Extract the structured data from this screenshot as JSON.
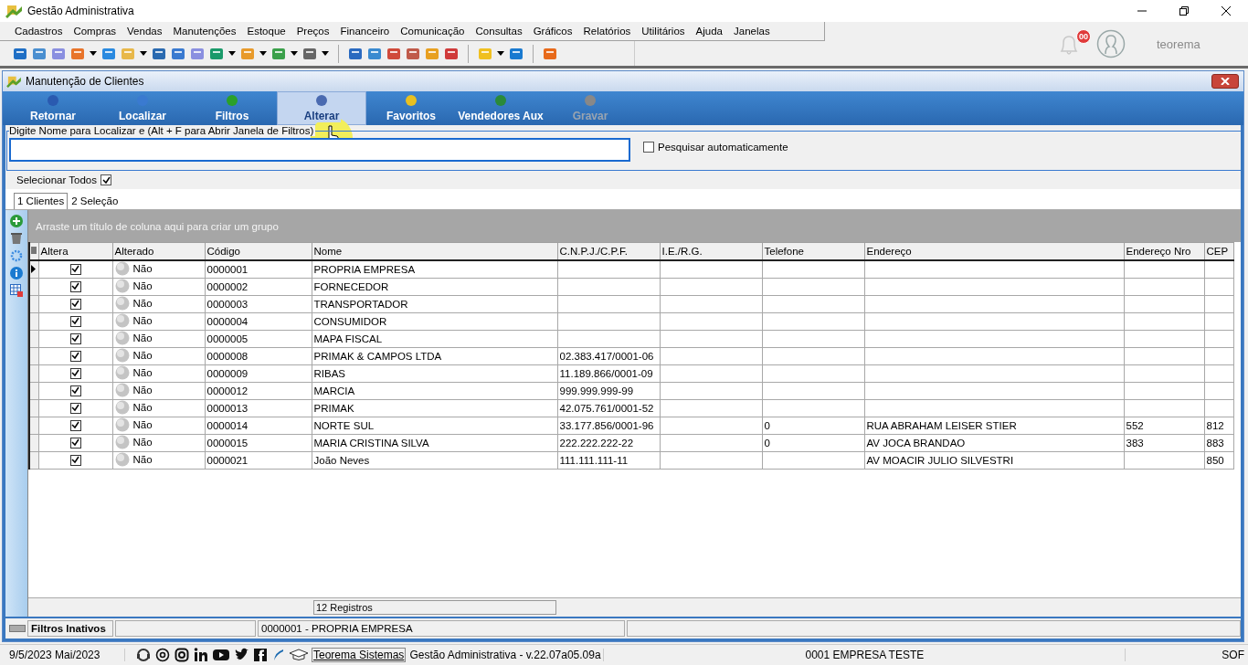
{
  "window": {
    "title": "Gestão Administrativa"
  },
  "menu": [
    "Cadastros",
    "Compras",
    "Vendas",
    "Manutenções",
    "Estoque",
    "Preços",
    "Financeiro",
    "Comunicação",
    "Consultas",
    "Gráficos",
    "Relatórios",
    "Utilitários",
    "Ajuda",
    "Janelas"
  ],
  "user": {
    "notifications": "00",
    "name": "teorema"
  },
  "child_window": {
    "title": "Manutenção de Clientes"
  },
  "ribbon": [
    {
      "label": "Retornar",
      "selected": false,
      "disabled": false
    },
    {
      "label": "Localizar",
      "selected": false,
      "disabled": false
    },
    {
      "label": "Filtros",
      "selected": false,
      "disabled": false
    },
    {
      "label": "Alterar",
      "selected": true,
      "disabled": false
    },
    {
      "label": "Favoritos",
      "selected": false,
      "disabled": false
    },
    {
      "label": "Vendedores Aux",
      "selected": false,
      "disabled": false
    },
    {
      "label": "Gravar",
      "selected": false,
      "disabled": true
    }
  ],
  "search": {
    "legend": "Digite Nome para Localizar e (Alt + F para Abrir Janela de Filtros)",
    "auto_search": {
      "label": "Pesquisar automaticamente",
      "checked": false
    }
  },
  "select_all": {
    "label": "Selecionar Todos",
    "checked": true
  },
  "tabs": [
    {
      "label": "1 Clientes",
      "selected": true
    },
    {
      "label": "2 Seleção",
      "selected": false
    }
  ],
  "group_hint": "Arraste um título de coluna aqui para criar um grupo",
  "table": {
    "columns": [
      "Altera",
      "Alterado",
      "Código",
      "Nome",
      "C.N.P.J./C.P.F.",
      "I.E./R.G.",
      "Telefone",
      "Endereço",
      "Endereço Nro",
      "CEP"
    ],
    "rows": [
      {
        "current": true,
        "checked": true,
        "cells": [
          "",
          "Não",
          "0000001",
          "PROPRIA EMPRESA",
          "",
          "",
          "",
          "",
          "",
          ""
        ]
      },
      {
        "current": false,
        "checked": true,
        "cells": [
          "",
          "Não",
          "0000002",
          "FORNECEDOR",
          "",
          "",
          "",
          "",
          "",
          ""
        ]
      },
      {
        "current": false,
        "checked": true,
        "cells": [
          "",
          "Não",
          "0000003",
          "TRANSPORTADOR",
          "",
          "",
          "",
          "",
          "",
          ""
        ]
      },
      {
        "current": false,
        "checked": true,
        "cells": [
          "",
          "Não",
          "0000004",
          "CONSUMIDOR",
          "",
          "",
          "",
          "",
          "",
          ""
        ]
      },
      {
        "current": false,
        "checked": true,
        "cells": [
          "",
          "Não",
          "0000005",
          "MAPA FISCAL",
          "",
          "",
          "",
          "",
          "",
          ""
        ]
      },
      {
        "current": false,
        "checked": true,
        "cells": [
          "",
          "Não",
          "0000008",
          " PRIMAK & CAMPOS LTDA",
          "02.383.417/0001-06",
          "",
          "",
          "",
          "",
          ""
        ]
      },
      {
        "current": false,
        "checked": true,
        "cells": [
          "",
          "Não",
          "0000009",
          "RIBAS",
          "11.189.866/0001-09",
          "",
          "",
          "",
          "",
          ""
        ]
      },
      {
        "current": false,
        "checked": true,
        "cells": [
          "",
          "Não",
          "0000012",
          "MARCIA",
          "999.999.999-99",
          "",
          "",
          "",
          "",
          ""
        ]
      },
      {
        "current": false,
        "checked": true,
        "cells": [
          "",
          "Não",
          "0000013",
          "PRIMAK",
          "42.075.761/0001-52",
          "",
          "",
          "",
          "",
          ""
        ]
      },
      {
        "current": false,
        "checked": true,
        "cells": [
          "",
          "Não",
          "0000014",
          "NORTE SUL",
          "33.177.856/0001-96",
          "",
          "0",
          "RUA ABRAHAM LEISER STIER",
          "552",
          "812"
        ]
      },
      {
        "current": false,
        "checked": true,
        "cells": [
          "",
          "Não",
          "0000015",
          "MARIA CRISTINA SILVA",
          "222.222.222-22",
          "",
          "0",
          "AV JOCA BRANDAO",
          "383",
          "883"
        ]
      },
      {
        "current": false,
        "checked": true,
        "cells": [
          "",
          "Não",
          "0000021",
          "João Neves",
          "111.111.111-11",
          "",
          "",
          "AV MOACIR JULIO SILVESTRI",
          "",
          "850"
        ]
      }
    ]
  },
  "footer": {
    "count": "12 Registros"
  },
  "status": [
    "Filtros Inativos",
    "0000001 - PROPRIA EMPRESA"
  ],
  "bottom": {
    "date": "9/5/2023 Mai/2023",
    "link": "Teorema Sistemas",
    "version": "Gestão Administrativa - v.22.07a05.09a",
    "company": "0001 EMPRESA TESTE",
    "extra": "SOF"
  }
}
